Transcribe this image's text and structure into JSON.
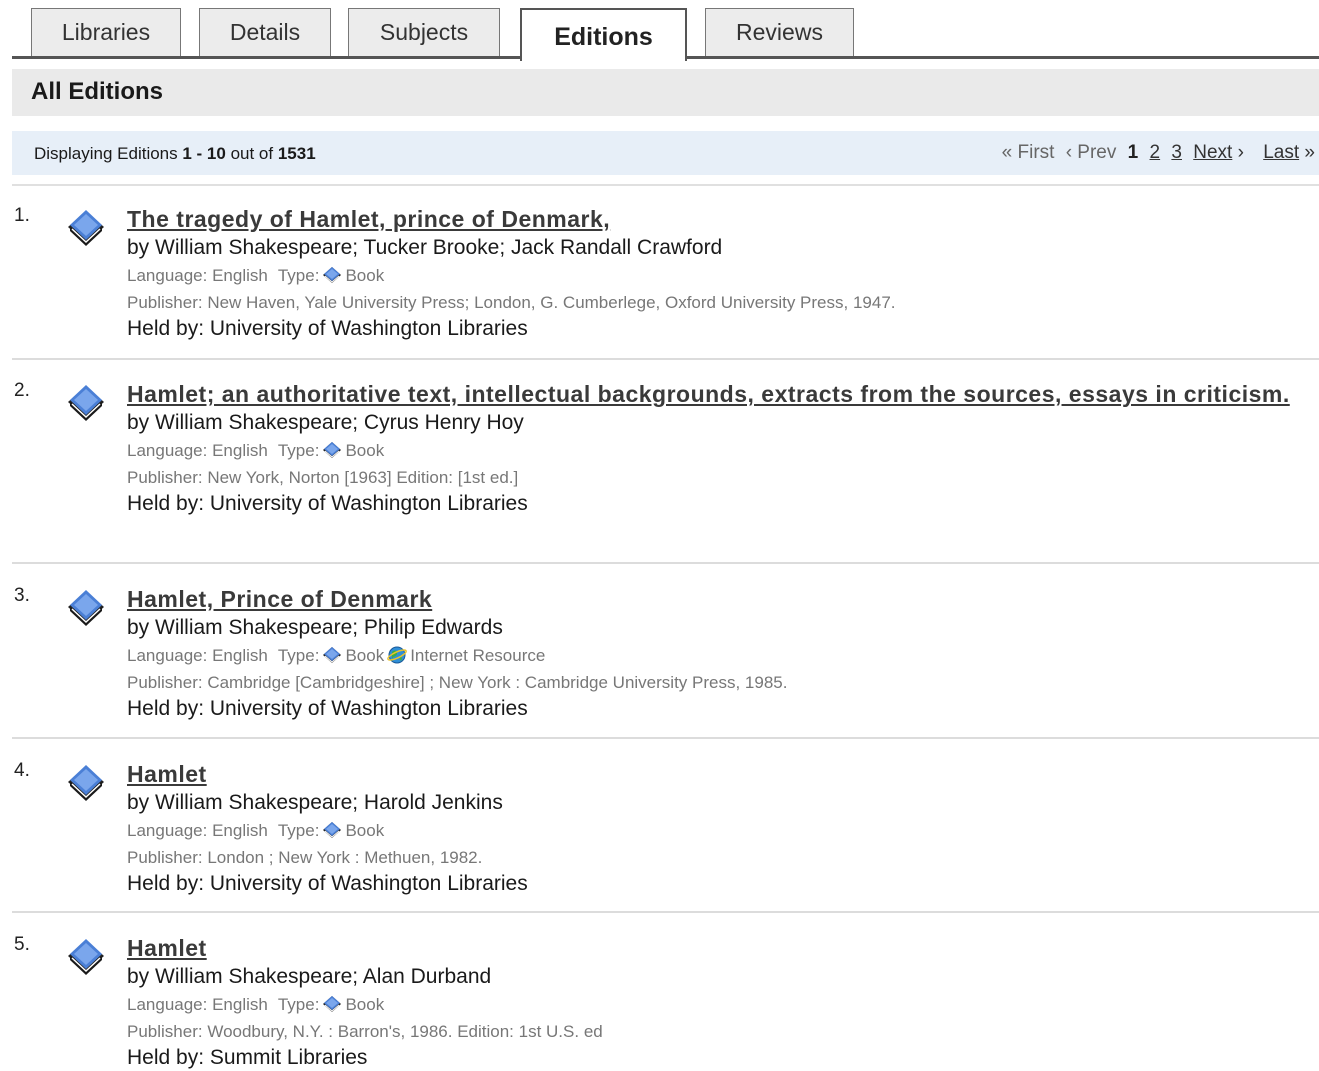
{
  "tabs": [
    {
      "label": "Libraries"
    },
    {
      "label": "Details"
    },
    {
      "label": "Subjects"
    },
    {
      "label": "Editions"
    },
    {
      "label": "Reviews"
    }
  ],
  "header": {
    "title": "All Editions"
  },
  "pager": {
    "display_prefix": "Displaying Editions ",
    "range": "1 - 10",
    "out_of": " out of ",
    "total": "1531",
    "first": "« First",
    "prev": "‹ Prev",
    "current": "1",
    "page2": "2",
    "page3": "3",
    "next": "Next",
    "next_arrow": "›",
    "last": "Last",
    "last_arrow": "»"
  },
  "labels": {
    "language_prefix": "Language: ",
    "type_prefix": "Type:",
    "publisher_prefix": "Publisher: ",
    "held_prefix": "Held by: "
  },
  "results": [
    {
      "num": "1.",
      "title": "The tragedy of Hamlet, prince of Denmark,",
      "authors": "by William Shakespeare; Tucker Brooke; Jack Randall Crawford",
      "language": "English",
      "types": [
        "Book"
      ],
      "publisher": "New Haven, Yale University Press; London, G. Cumberlege, Oxford University Press, 1947.",
      "held_by": "University of Washington Libraries"
    },
    {
      "num": "2.",
      "title": "Hamlet; an authoritative text, intellectual backgrounds, extracts from the sources, essays in criticism.",
      "authors": "by William Shakespeare; Cyrus Henry Hoy",
      "language": "English",
      "types": [
        "Book"
      ],
      "publisher": "New York, Norton [1963] Edition: [1st ed.]",
      "held_by": "University of Washington Libraries"
    },
    {
      "num": "3.",
      "title": "Hamlet, Prince of Denmark",
      "authors": "by William Shakespeare; Philip Edwards",
      "language": "English",
      "types": [
        "Book",
        "Internet Resource"
      ],
      "publisher": "Cambridge [Cambridgeshire] ; New York : Cambridge University Press, 1985.",
      "held_by": "University of Washington Libraries"
    },
    {
      "num": "4.",
      "title": "Hamlet",
      "authors": "by William Shakespeare; Harold Jenkins",
      "language": "English",
      "types": [
        "Book"
      ],
      "publisher": "London ; New York : Methuen, 1982.",
      "held_by": "University of Washington Libraries"
    },
    {
      "num": "5.",
      "title": "Hamlet",
      "authors": "by William Shakespeare; Alan Durband",
      "language": "English",
      "types": [
        "Book"
      ],
      "publisher": "Woodbury, N.Y. : Barron's, 1986. Edition: 1st U.S. ed",
      "held_by": "Summit Libraries"
    }
  ],
  "icons": {
    "book": "book-icon",
    "internet": "internet-resource-icon"
  },
  "colors": {
    "book_blue": "#4a7fd6",
    "pager_bg": "#e7eff8",
    "header_bg": "#eaeaea"
  }
}
